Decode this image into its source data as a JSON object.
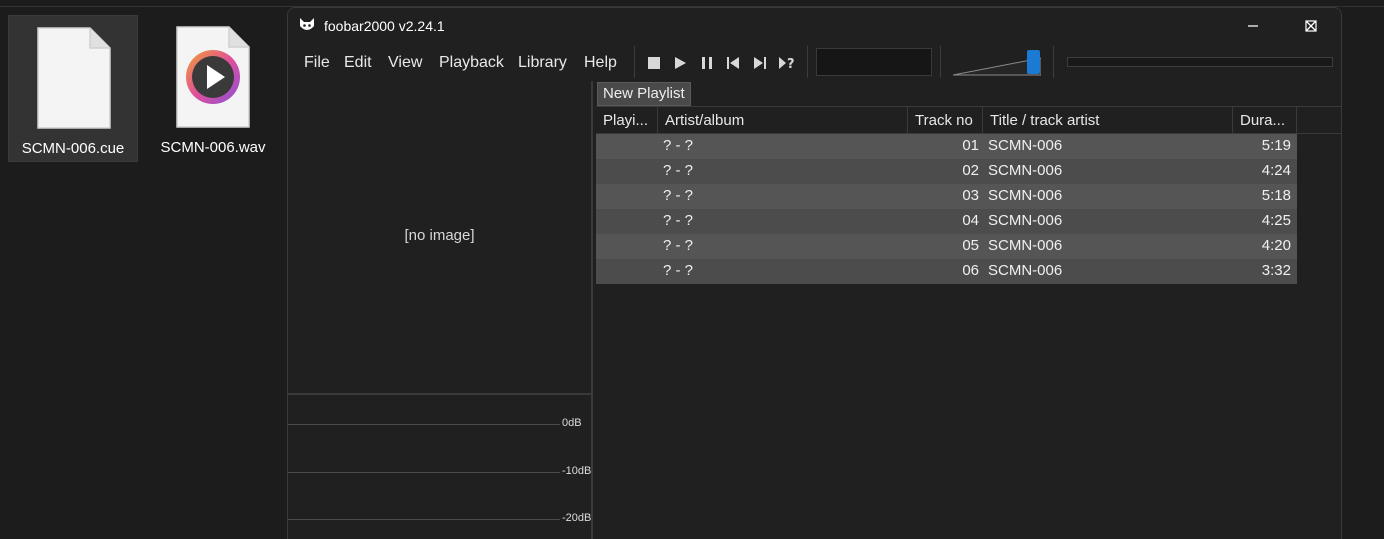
{
  "desktop": {
    "files": [
      {
        "label": "SCMN-006.cue",
        "icon": "document-icon"
      },
      {
        "label": "SCMN-006.wav",
        "icon": "media-file-icon"
      }
    ]
  },
  "window": {
    "title": "foobar2000 v2.24.1",
    "menu": [
      "File",
      "Edit",
      "View",
      "Playback",
      "Library",
      "Help"
    ],
    "no_image_text": "[no image]",
    "vu_labels": [
      "0dB",
      "-10dB",
      "-20dB"
    ],
    "playlist_tab": "New Playlist",
    "columns": [
      "Playi...",
      "Artist/album",
      "Track no",
      "Title / track artist",
      "Dura..."
    ],
    "tracks": [
      {
        "artist_album": "? - ?",
        "track_no": "01",
        "title": "SCMN-006",
        "duration": "5:19"
      },
      {
        "artist_album": "? - ?",
        "track_no": "02",
        "title": "SCMN-006",
        "duration": "4:24"
      },
      {
        "artist_album": "? - ?",
        "track_no": "03",
        "title": "SCMN-006",
        "duration": "5:18"
      },
      {
        "artist_album": "? - ?",
        "track_no": "04",
        "title": "SCMN-006",
        "duration": "4:25"
      },
      {
        "artist_album": "? - ?",
        "track_no": "05",
        "title": "SCMN-006",
        "duration": "4:20"
      },
      {
        "artist_album": "? - ?",
        "track_no": "06",
        "title": "SCMN-006",
        "duration": "3:32"
      }
    ],
    "accent_color": "#1a7ad4"
  }
}
